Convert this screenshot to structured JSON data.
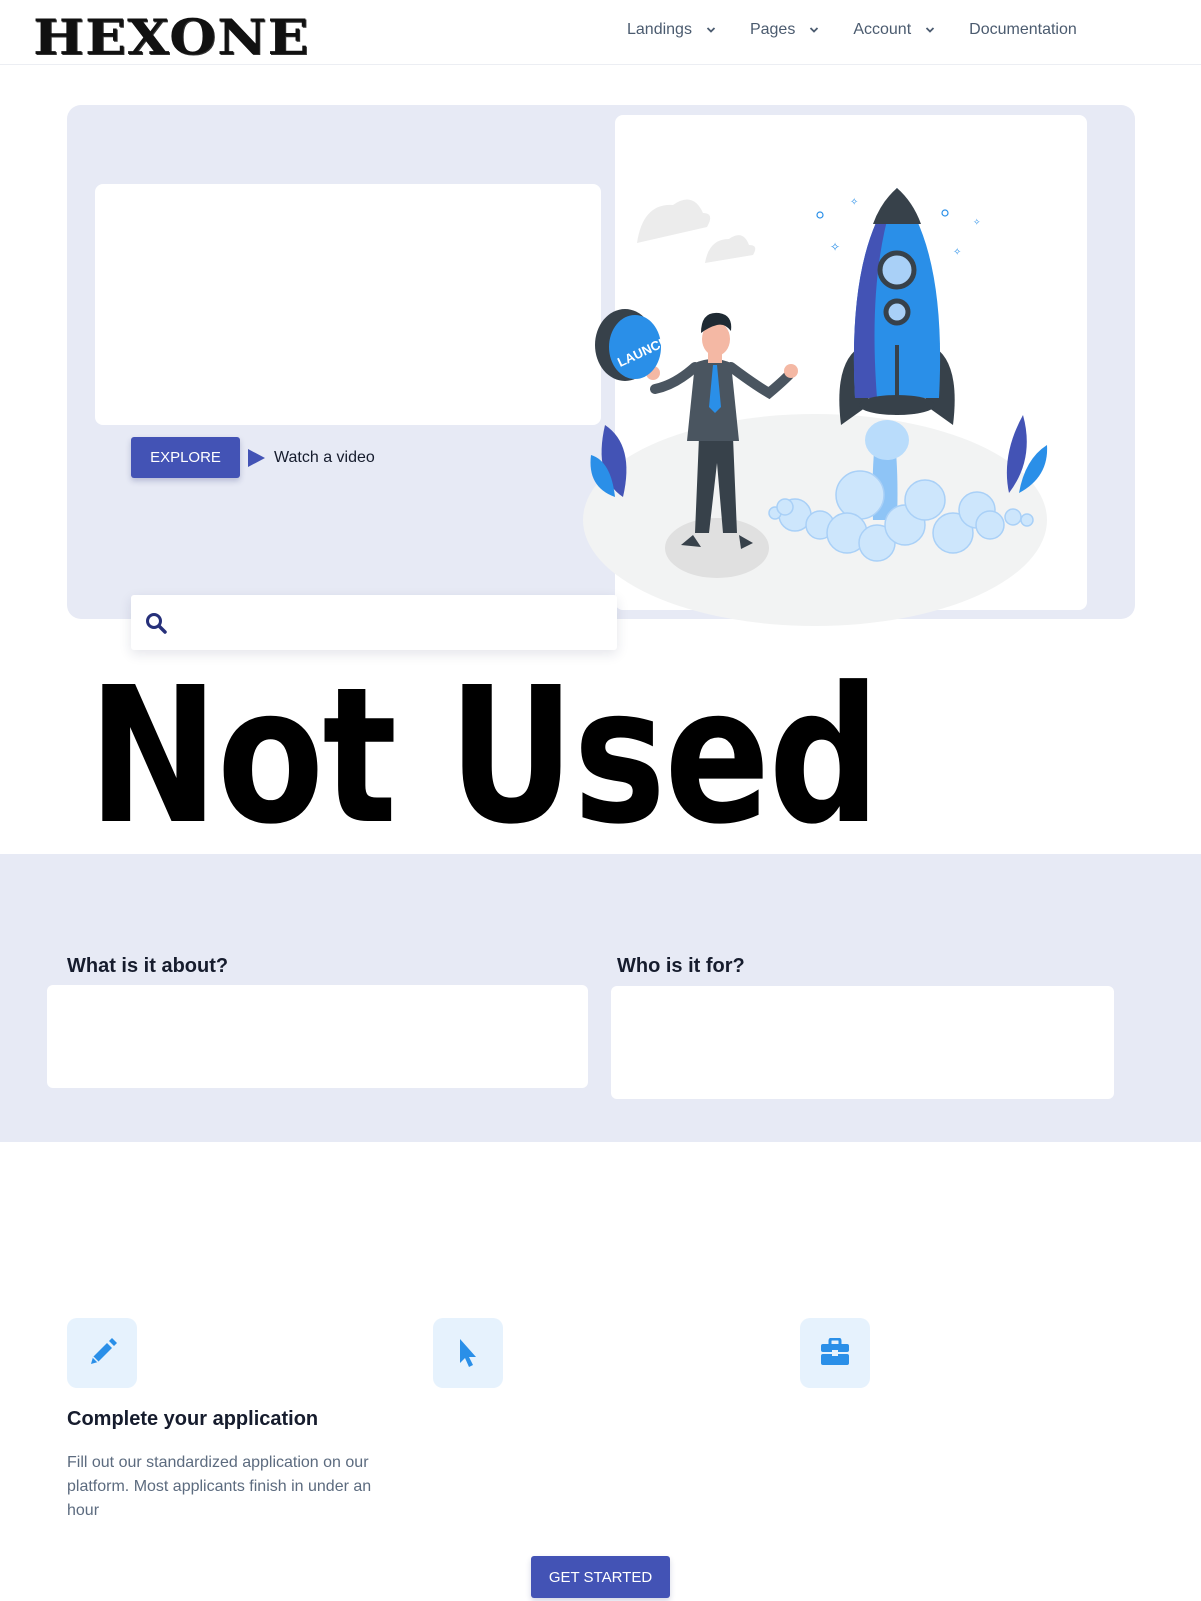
{
  "brand": {
    "logo_text": "HEXONE"
  },
  "nav": {
    "items": [
      {
        "label": "Landings",
        "has_dropdown": true
      },
      {
        "label": "Pages",
        "has_dropdown": true
      },
      {
        "label": "Account",
        "has_dropdown": true
      },
      {
        "label": "Documentation",
        "has_dropdown": false
      }
    ]
  },
  "hero": {
    "explore_label": "EXPLORE",
    "watch_label": "Watch a video",
    "search_placeholder": "",
    "illustration_badge": "LAUNCH"
  },
  "overlay_text": "Not Used",
  "about": {
    "what_title": "What is it about?",
    "who_title": "Who is it for?"
  },
  "features": [
    {
      "icon": "pencil-icon",
      "title": "Complete your application",
      "text": "Fill out our standardized application on our platform. Most applicants finish in under an hour"
    },
    {
      "icon": "cursor-icon"
    },
    {
      "icon": "briefcase-icon"
    }
  ],
  "cta": {
    "label": "GET STARTED"
  },
  "colors": {
    "primary": "#4353b5",
    "accent_blue": "#2a8fe8",
    "section_bg": "#e7eaf5",
    "icon_bg": "#e6f2fd"
  }
}
